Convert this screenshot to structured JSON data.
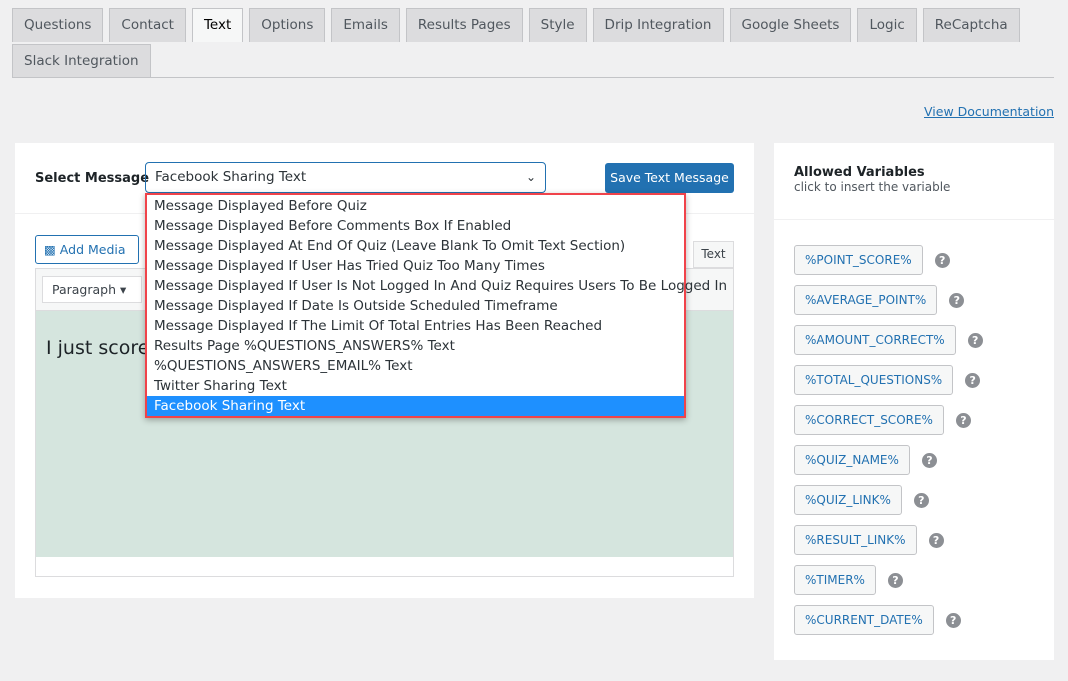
{
  "tabs": [
    "Questions",
    "Contact",
    "Text",
    "Options",
    "Emails",
    "Results Pages",
    "Style",
    "Drip Integration",
    "Google Sheets",
    "Logic",
    "ReCaptcha",
    "Slack Integration"
  ],
  "active_tab": "Text",
  "view_documentation": "View Documentation",
  "select_message_label": "Select Message",
  "select_value": "Facebook Sharing Text",
  "save_button": "Save Text Message",
  "add_media": "Add Media",
  "text_tab": "Text",
  "format_select": "Paragraph",
  "editor_content": "I just scored",
  "options": [
    "Message Displayed Before Quiz",
    "Message Displayed Before Comments Box If Enabled",
    "Message Displayed At End Of Quiz (Leave Blank To Omit Text Section)",
    "Message Displayed If User Has Tried Quiz Too Many Times",
    "Message Displayed If User Is Not Logged In And Quiz Requires Users To Be Logged In",
    "Message Displayed If Date Is Outside Scheduled Timeframe",
    "Message Displayed If The Limit Of Total Entries Has Been Reached",
    "Results Page %QUESTIONS_ANSWERS% Text",
    "%QUESTIONS_ANSWERS_EMAIL% Text",
    "Twitter Sharing Text",
    "Facebook Sharing Text"
  ],
  "selected_option_index": 10,
  "sidebar": {
    "title": "Allowed Variables",
    "subtitle": "click to insert the variable",
    "variables": [
      "%POINT_SCORE%",
      "%AVERAGE_POINT%",
      "%AMOUNT_CORRECT%",
      "%TOTAL_QUESTIONS%",
      "%CORRECT_SCORE%",
      "%QUIZ_NAME%",
      "%QUIZ_LINK%",
      "%RESULT_LINK%",
      "%TIMER%",
      "%CURRENT_DATE%"
    ],
    "help_glyph": "?"
  },
  "colors": {
    "accent": "#2271b1",
    "highlight": "#1e90ff",
    "dropdown_border": "#f0434a",
    "editor_bg": "#d5e5de"
  }
}
